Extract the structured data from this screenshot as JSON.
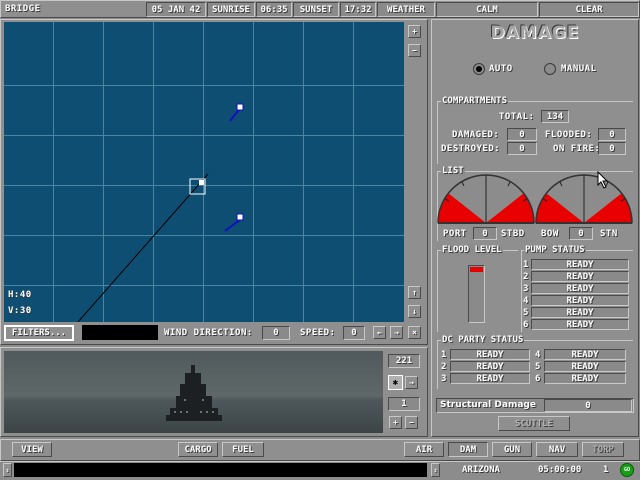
{
  "topbar": {
    "title": "BRIDGE",
    "date": "05 JAN 42",
    "sunrise_label": "SUNRISE",
    "sunrise_time": "06:35",
    "sunset_label": "SUNSET",
    "sunset_time": "17:32",
    "weather_label": "WEATHER",
    "weather_value1": "CALM",
    "weather_value2": "CLEAR"
  },
  "map": {
    "h_label": "H:40",
    "v_label": "V:30",
    "filters_label": "FILTERS...",
    "wind_label": "WIND DIRECTION:",
    "wind_value": "0",
    "speed_label": "SPEED:",
    "speed_value": "0",
    "plus": "+",
    "minus": "−",
    "up": "↑",
    "down": "↓",
    "left": "←",
    "right": "→",
    "close": "×"
  },
  "view": {
    "heading": "221",
    "index": "1",
    "plus": "+",
    "minus": "−"
  },
  "damage": {
    "title": "DAMAGE",
    "auto_label": "AUTO",
    "manual_label": "MANUAL",
    "mode_selected": "auto",
    "compartments_title": "COMPARTMENTS",
    "total_label": "TOTAL:",
    "total_value": "134",
    "damaged_label": "DAMAGED:",
    "damaged_value": "0",
    "flooded_label": "FLOODED:",
    "flooded_value": "0",
    "destroyed_label": "DESTROYED:",
    "destroyed_value": "0",
    "on_fire_label": "ON FIRE:",
    "on_fire_value": "0",
    "list_title": "LIST",
    "port_label": "PORT",
    "port_value": "0",
    "stbd_label": "STBD",
    "bow_label": "BOW",
    "bow_value": "0",
    "stn_label": "STN",
    "flood_title": "FLOOD LEVEL",
    "flood_level": 0.1,
    "pump_title": "PUMP STATUS",
    "pumps": [
      {
        "n": "1",
        "status": "READY"
      },
      {
        "n": "2",
        "status": "READY"
      },
      {
        "n": "3",
        "status": "READY"
      },
      {
        "n": "4",
        "status": "READY"
      },
      {
        "n": "5",
        "status": "READY"
      },
      {
        "n": "6",
        "status": "READY"
      }
    ],
    "dc_title": "DC PARTY STATUS",
    "dc_parties": [
      {
        "n": "1",
        "status": "READY"
      },
      {
        "n": "2",
        "status": "READY"
      },
      {
        "n": "3",
        "status": "READY"
      },
      {
        "n": "4",
        "status": "READY"
      },
      {
        "n": "5",
        "status": "READY"
      },
      {
        "n": "6",
        "status": "READY"
      }
    ],
    "structural_label": "Structural Damage",
    "structural_value": "0",
    "scuttle_label": "SCUTTLE"
  },
  "bottombar": {
    "view": "VIEW",
    "cargo": "CARGO",
    "fuel": "FUEL",
    "air": "AIR",
    "dam": "DAM",
    "gun": "GUN",
    "nav": "NAV",
    "torp": "TORP"
  },
  "statusbar": {
    "ship": "ARIZONA",
    "time": "05:00:00",
    "speed": "1",
    "go": "GO"
  },
  "colors": {
    "sea": "#0f4e73",
    "grid": "#4a85a3",
    "damage_red": "#e80000",
    "panel": "#8c8c8c"
  }
}
